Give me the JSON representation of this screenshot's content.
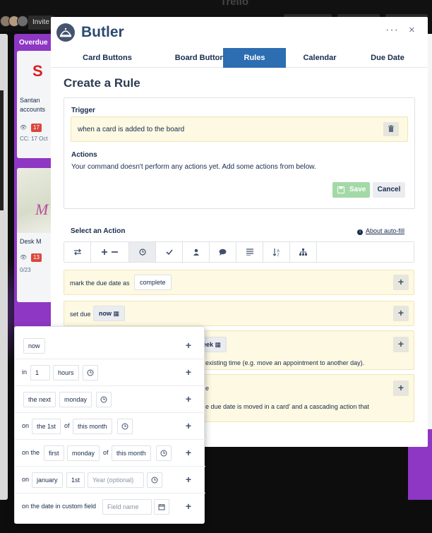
{
  "background": {
    "app_logo": "Trello",
    "invite_label": "Invite",
    "overdue_list_title": "Overdue",
    "cards": [
      {
        "title_line1": "Santan",
        "title_line2": "accounts",
        "badge": "17",
        "meta": "CC: 17 Oct"
      },
      {
        "title": "Desk M",
        "meta": "0/23",
        "badge": "13"
      }
    ]
  },
  "modal": {
    "title": "Butler",
    "more_label": "···",
    "close_label": "×",
    "tabs": [
      {
        "label": "Card Buttons",
        "active": false
      },
      {
        "label": "Board Buttons",
        "active": false
      },
      {
        "label": "Rules",
        "active": true
      },
      {
        "label": "Calendar",
        "active": false
      },
      {
        "label": "Due Date",
        "active": false
      }
    ],
    "heading": "Create a Rule",
    "trigger_label": "Trigger",
    "trigger_text": "when a card is added to the board",
    "actions_label": "Actions",
    "actions_empty": "Your command doesn't perform any actions yet. Add some actions from below.",
    "save_label": "Save",
    "cancel_label": "Cancel",
    "select_action_label": "Select an Action",
    "autofill_label": "About auto-fill",
    "action_icons": [
      "move-icon",
      "add-remove-icon",
      "clock-icon",
      "check-icon",
      "user-icon",
      "comment-icon",
      "description-icon",
      "sort-icon",
      "hierarchy-icon"
    ],
    "action_rows": {
      "mark_due_text": "mark the due date as",
      "mark_due_value": "complete",
      "set_due_text": "set due",
      "set_due_value": "now",
      "partial_chip": "eek",
      "partial_text_1": "existing time (e.g. move an appointment to another day).",
      "partial_title_2": "e",
      "partial_text_2": "e due date is moved in a card' and a cascading action that"
    }
  },
  "dropdown": {
    "row1": {
      "chip": "now"
    },
    "row2": {
      "prefix": "in",
      "number": "1",
      "unit": "hours"
    },
    "row3": {
      "chip1": "the next",
      "chip2": "monday"
    },
    "row4": {
      "prefix": "on",
      "day": "the 1st",
      "of": "of",
      "period": "this month"
    },
    "row5": {
      "prefix": "on the",
      "ordinal": "first",
      "weekday": "monday",
      "of": "of",
      "period": "this month"
    },
    "row6": {
      "prefix": "on",
      "month": "january",
      "day": "1st",
      "year_placeholder": "Year (optional)"
    },
    "row7": {
      "text": "on the date in custom field",
      "field_placeholder": "Field name"
    },
    "plus_label": "+"
  },
  "colors": {
    "brand_blue": "#2d6db2",
    "title_navy": "#2b4a70",
    "save_green": "#a3d9a6",
    "row_yellow": "#fdf9e2",
    "list_purple": "#8e37c4"
  }
}
